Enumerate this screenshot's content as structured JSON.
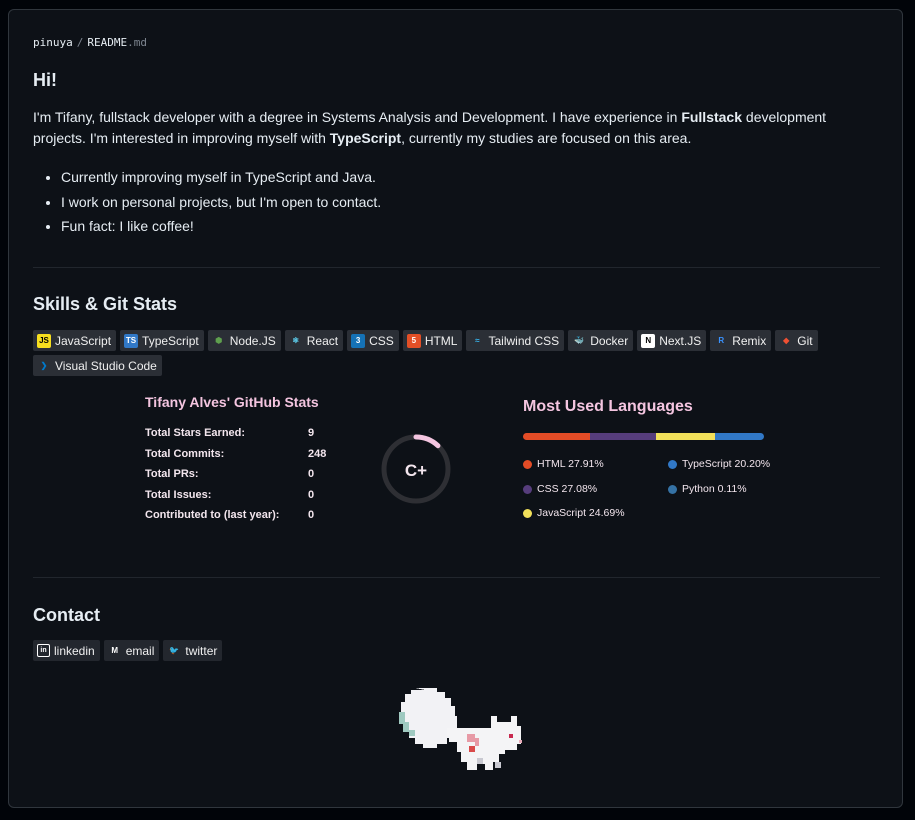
{
  "breadcrumb": {
    "owner": "pinuya",
    "separator": "/",
    "file_name": "README",
    "file_ext": ".md"
  },
  "intro": {
    "heading": "Hi!",
    "p1": "I'm Tifany, fullstack developer with a degree in Systems Analysis and Development. I have experience in ",
    "bold1": "Fullstack",
    "p2": " development projects. I'm interested in improving myself with ",
    "bold2": "TypeScript",
    "p3": ", currently my studies are focused on this area.",
    "bullets": [
      "Currently improving myself in TypeScript and Java.",
      "I work on personal projects, but I'm open to contact.",
      "Fun fact: I like coffee!"
    ]
  },
  "skills": {
    "heading": "Skills & Git Stats",
    "badges": [
      {
        "label": "JavaScript",
        "icon": "javascript-icon",
        "glyph": "JS",
        "icon_bg": "#f7df1e",
        "icon_fg": "#000000"
      },
      {
        "label": "TypeScript",
        "icon": "typescript-icon",
        "glyph": "TS",
        "icon_bg": "#3178c6",
        "icon_fg": "#ffffff"
      },
      {
        "label": "Node.JS",
        "icon": "nodejs-icon",
        "glyph": "⬢",
        "icon_bg": "transparent",
        "icon_fg": "#5fa04e"
      },
      {
        "label": "React",
        "icon": "react-icon",
        "glyph": "⚛",
        "icon_bg": "transparent",
        "icon_fg": "#61dafb"
      },
      {
        "label": "CSS",
        "icon": "css-icon",
        "glyph": "3",
        "icon_bg": "#1572b6",
        "icon_fg": "#ffffff"
      },
      {
        "label": "HTML",
        "icon": "html-icon",
        "glyph": "5",
        "icon_bg": "#e34f26",
        "icon_fg": "#ffffff"
      },
      {
        "label": "Tailwind CSS",
        "icon": "tailwind-icon",
        "glyph": "≈",
        "icon_bg": "transparent",
        "icon_fg": "#38bdf8"
      },
      {
        "label": "Docker",
        "icon": "docker-icon",
        "glyph": "🐳",
        "icon_bg": "transparent",
        "icon_fg": "#2496ed"
      },
      {
        "label": "Next.JS",
        "icon": "nextjs-icon",
        "glyph": "N",
        "icon_bg": "#ffffff",
        "icon_fg": "#000000"
      },
      {
        "label": "Remix",
        "icon": "remix-icon",
        "glyph": "R",
        "icon_bg": "transparent",
        "icon_fg": "#3992ff"
      },
      {
        "label": "Git",
        "icon": "git-icon",
        "glyph": "◆",
        "icon_bg": "transparent",
        "icon_fg": "#f05032"
      },
      {
        "label": "Visual Studio Code",
        "icon": "vscode-icon",
        "glyph": "❯",
        "icon_bg": "transparent",
        "icon_fg": "#007acc"
      }
    ]
  },
  "github_stats": {
    "title": "Tifany Alves' GitHub Stats",
    "rows": [
      {
        "label": "Total Stars Earned:",
        "value": "9"
      },
      {
        "label": "Total Commits:",
        "value": "248"
      },
      {
        "label": "Total PRs:",
        "value": "0"
      },
      {
        "label": "Total Issues:",
        "value": "0"
      },
      {
        "label": "Contributed to (last year):",
        "value": "0"
      }
    ],
    "grade": "C+",
    "ring_fraction": 0.12,
    "ring_color": "#f4c5e0"
  },
  "languages": {
    "title": "Most Used Languages",
    "items": [
      {
        "name": "HTML",
        "percent": 27.91,
        "label": "HTML 27.91%",
        "color": "#e34c26"
      },
      {
        "name": "CSS",
        "percent": 27.08,
        "label": "CSS 27.08%",
        "color": "#563d7c"
      },
      {
        "name": "JavaScript",
        "percent": 24.69,
        "label": "JavaScript 24.69%",
        "color": "#f1e05a"
      },
      {
        "name": "TypeScript",
        "percent": 20.2,
        "label": "TypeScript 20.20%",
        "color": "#3178c6"
      },
      {
        "name": "Python",
        "percent": 0.11,
        "label": "Python 0.11%",
        "color": "#3572a5"
      }
    ]
  },
  "contact": {
    "heading": "Contact",
    "badges": [
      {
        "label": "linkedin",
        "icon": "linkedin-icon",
        "glyph": "in"
      },
      {
        "label": "email",
        "icon": "gmail-icon",
        "glyph": "M"
      },
      {
        "label": "twitter",
        "icon": "twitter-icon",
        "glyph": "🐦"
      }
    ]
  },
  "mascot": {
    "icon": "white-squirrel-pixel-art"
  }
}
